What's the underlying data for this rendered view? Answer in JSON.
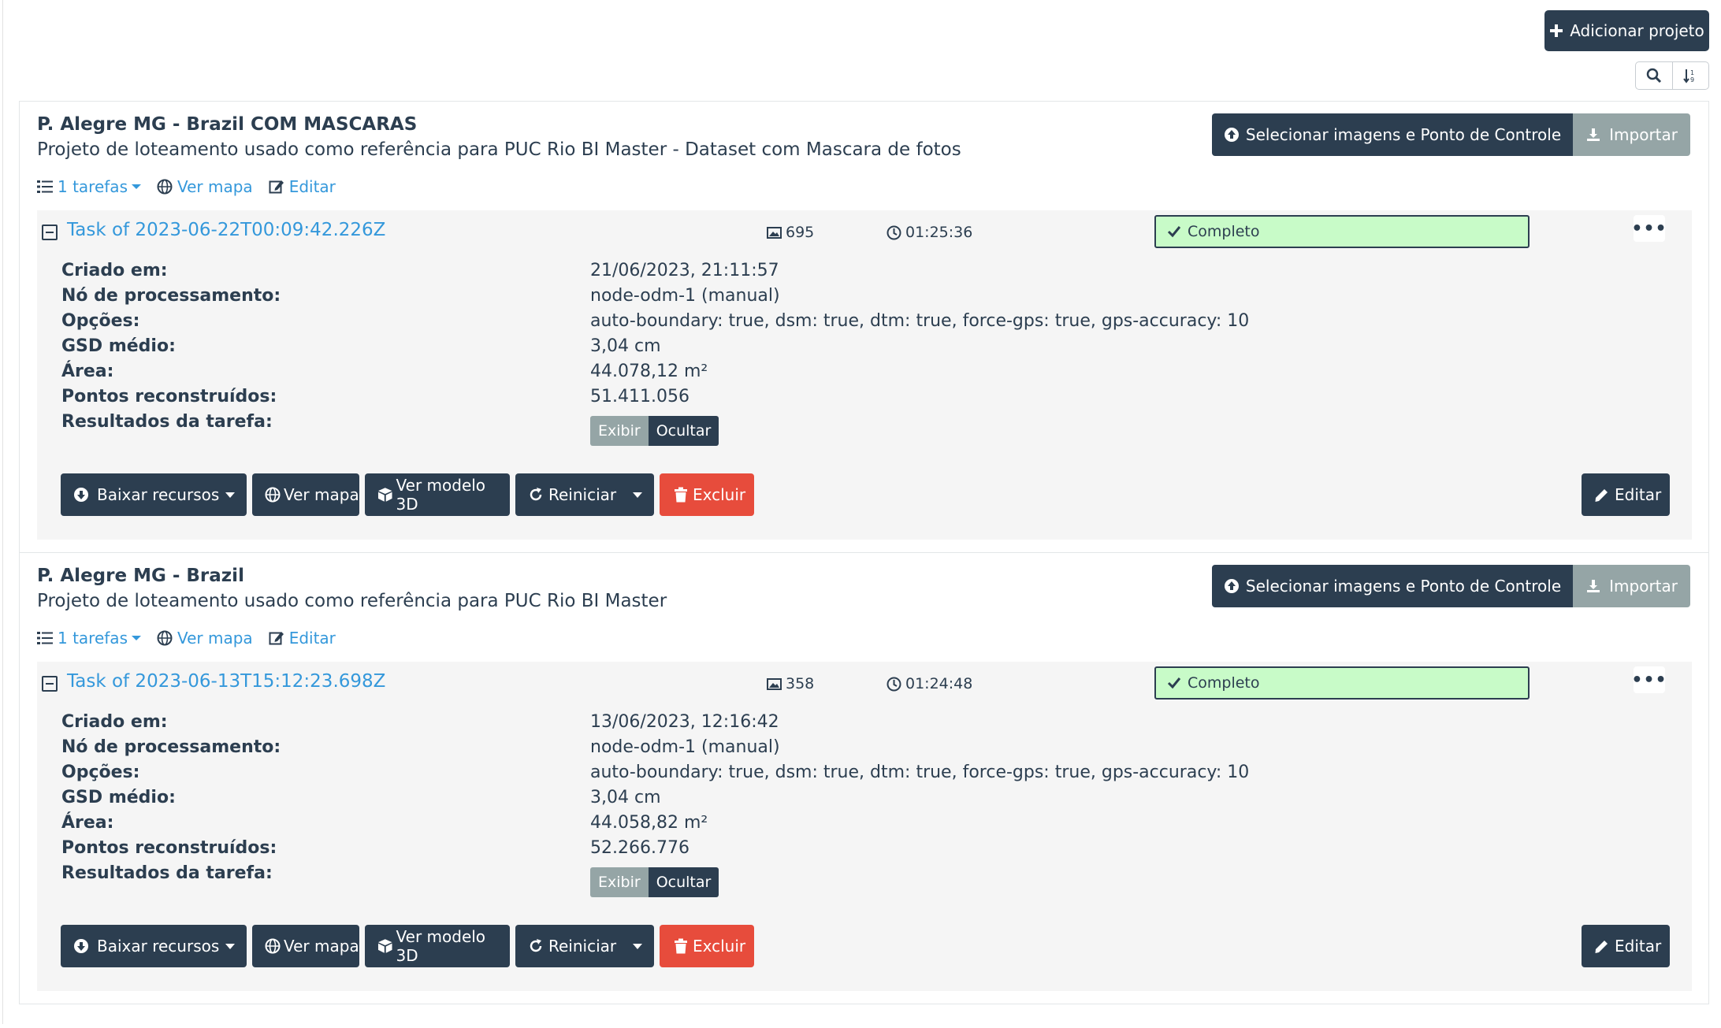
{
  "header": {
    "add_project_label": "Adicionar projeto"
  },
  "toolbar": {
    "search_icon": "search-icon",
    "sort_icon": "sort-icon"
  },
  "colors": {
    "primary_dark": "#2c3e50",
    "link_blue": "#3498db",
    "muted_gray": "#95a5a6",
    "danger_red": "#e74c3c",
    "success_bg": "#c8fbc8"
  },
  "labels": {
    "select_images": "Selecionar imagens e Ponto de Controle",
    "import": "Importar",
    "tasks_count": "1 tarefas",
    "view_map": "Ver mapa",
    "edit": "Editar",
    "created": "Criado em:",
    "node": "Nó de processamento:",
    "options": "Opções:",
    "gsd": "GSD médio:",
    "area": "Área:",
    "points": "Pontos reconstruídos:",
    "results": "Resultados da tarefa:",
    "show": "Exibir",
    "hide": "Ocultar",
    "download": "Baixar recursos",
    "view_3d": "Ver modelo 3D",
    "restart": "Reiniciar",
    "delete": "Excluir",
    "more": "•••"
  },
  "projects": [
    {
      "name": "P. Alegre MG - Brazil COM MASCARAS",
      "description": "Projeto de loteamento usado como referência para PUC Rio BI Master - Dataset com Mascara de fotos",
      "task": {
        "name": "Task of 2023-06-22T00:09:42.226Z",
        "images": "695",
        "duration": "01:25:36",
        "status": "Completo",
        "created": "21/06/2023, 21:11:57",
        "node": "node-odm-1 (manual)",
        "options": "auto-boundary: true, dsm: true, dtm: true, force-gps: true, gps-accuracy: 10",
        "gsd": "3,04 cm",
        "area": "44.078,12 m²",
        "points": "51.411.056"
      }
    },
    {
      "name": "P. Alegre MG - Brazil",
      "description": "Projeto de loteamento usado como referência para PUC Rio BI Master",
      "task": {
        "name": "Task of 2023-06-13T15:12:23.698Z",
        "images": "358",
        "duration": "01:24:48",
        "status": "Completo",
        "created": "13/06/2023, 12:16:42",
        "node": "node-odm-1 (manual)",
        "options": "auto-boundary: true, dsm: true, dtm: true, force-gps: true, gps-accuracy: 10",
        "gsd": "3,04 cm",
        "area": "44.058,82 m²",
        "points": "52.266.776"
      }
    }
  ]
}
